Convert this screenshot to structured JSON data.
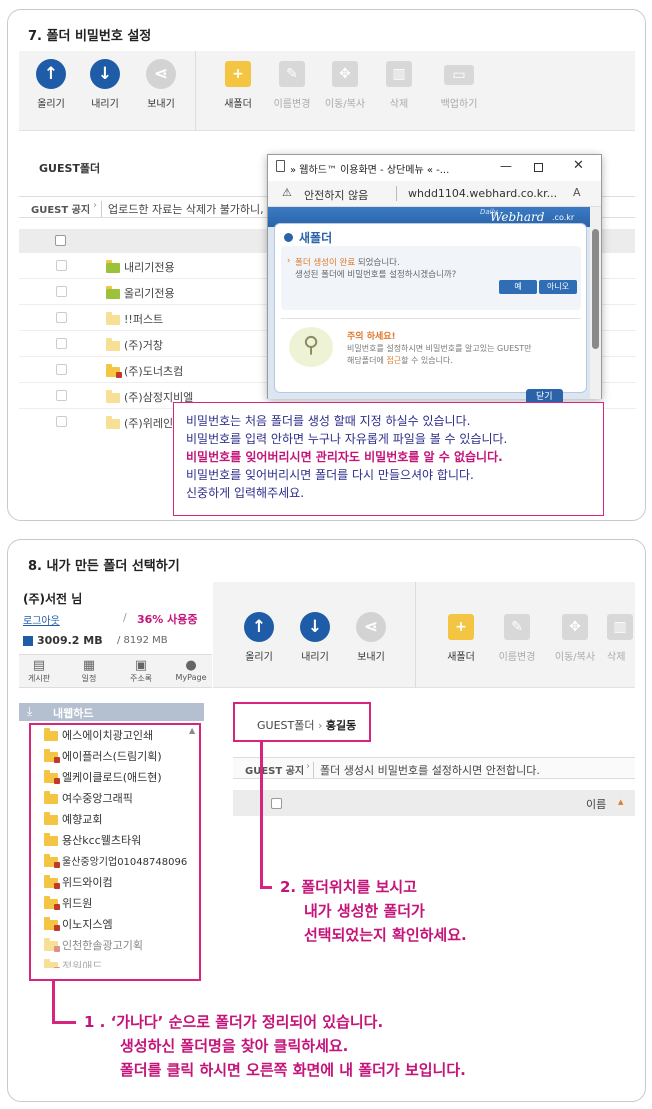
{
  "section1": {
    "title": "7. 폴더 비밀번호 설정",
    "toolbar": {
      "upload": "올리기",
      "download": "내리기",
      "send": "보내기",
      "new_folder": "새폴더",
      "rename": "이름변경",
      "move_copy": "이동/복사",
      "delete": "삭제",
      "backup": "백업하기"
    },
    "folder_title": "GUEST폴더",
    "notice_label": "GUEST 공지",
    "notice_text": "업로드한 자료는 삭제가 불가하니,",
    "rows": [
      "내리기전용",
      "올리기전용",
      "!!퍼스트",
      "(주)거창",
      "(주)도너츠컴",
      "(주)삼정지비엘",
      "(주)위레인"
    ],
    "popup": {
      "window_title": "» 웹하드™ 이용화면 - 상단메뉴 « -...",
      "security": "안전하지 않음",
      "url": "whdd1104.webhard.co.kr...",
      "brand": "Webhard",
      "brand_small": "Daily",
      "brand_domain": ".co.kr",
      "dialog_title": "새폴더",
      "msg_line1_a": "폴더 생성이 완료",
      "msg_line1_b": " 되었습니다.",
      "msg_line2": "생성된 폴더에 비밀번호를 설정하시겠습니까?",
      "yes": "예",
      "no": "아니오",
      "caution_title": "주의 하세요!",
      "caution_line1": "비밀번호를 설정하시면 비밀번호를 알고있는 GUEST만",
      "caution_line2_a": "해당폴더에 ",
      "caution_line2_b": "접근",
      "caution_line2_c": "할 수 있습니다.",
      "close": "닫기"
    },
    "info": {
      "line1": "비밀번호는 처음 폴더를 생성 할때 지정 하실수 있습니다.",
      "line2": "비밀번호를 입력 안하면 누구나 자유롭게 파일을 볼 수 있습니다.",
      "line3": "비밀번호를 잊어버리시면 관리자도 비밀번호를 알 수 없습니다.",
      "line4": "비밀번호를 잊어버리시면 폴더를 다시 만들으셔야 합니다.",
      "line5": "신중하게 입력해주세요."
    }
  },
  "section2": {
    "title": "8. 내가 만든 폴더 선택하기",
    "user": {
      "name": "(주)서전 님",
      "logout": "로그아웃",
      "usage_sep": "/",
      "usage": "36% 사용중",
      "storage_used": "3009.2 MB",
      "storage_total": "/ 8192 MB"
    },
    "nav_icons": [
      "게시판",
      "일정",
      "주소록",
      "MyPage"
    ],
    "my_webhard": "내웹하드",
    "tree": [
      "에스에이치광고인쇄",
      "에이플러스(드림기획)",
      "엘케이클로드(애드현)",
      "여수중앙그래픽",
      "예향교회",
      "용산kcc웰츠타워",
      "울산중앙기업01048748096",
      "위드와이컴",
      "위드원",
      "이노지스엠",
      "인천한솔광고기획",
      "정원애드"
    ],
    "toolbar": {
      "upload": "올리기",
      "download": "내리기",
      "send": "보내기",
      "new_folder": "새폴더",
      "rename": "이름변경",
      "move_copy": "이동/복사",
      "delete": "삭제"
    },
    "breadcrumb_root": "GUEST폴더",
    "breadcrumb_sep": "›",
    "breadcrumb_current": "홍길동",
    "notice_label": "GUEST 공지",
    "notice_text": "폴더 생성시 비밀번호를 설정하시면 안전합니다.",
    "col_name": "이름",
    "callout2": {
      "line1": "2. 폴더위치를 보시고",
      "line2": "내가 생성한 폴더가",
      "line3": "선택되었는지 확인하세요."
    },
    "callout1": {
      "line1": "1 . ‘가나다’ 순으로 폴더가 정리되어 있습니다.",
      "line2": "생성하신 폴더명을 찾아 클릭하세요.",
      "line3": "폴더를 클릭 하시면 오른쪽 화면에 내 폴더가 보입니다."
    }
  },
  "colors": {
    "accent_blue": "#1e5ca8",
    "magenta": "#c4147a",
    "folder": "#f4c542"
  }
}
